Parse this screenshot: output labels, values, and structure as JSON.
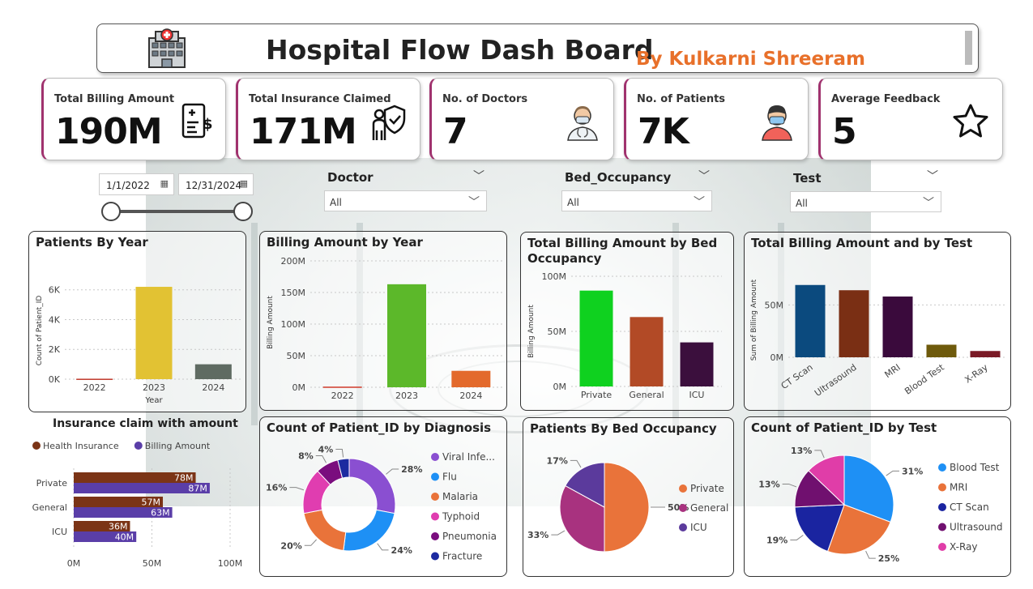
{
  "header": {
    "title": "Hospital Flow Dash Board",
    "author": "By Kulkarni Shreeram"
  },
  "kpis": [
    {
      "label": "Total Billing Amount",
      "value": "190M",
      "icon": "invoice-dollar-icon"
    },
    {
      "label": "Total Insurance Claimed",
      "value": "171M",
      "icon": "insurance-shield-icon"
    },
    {
      "label": "No. of Doctors",
      "value": "7",
      "icon": "doctor-icon"
    },
    {
      "label": "No. of Patients",
      "value": "7K",
      "icon": "patient-mask-icon"
    },
    {
      "label": "Average Feedback",
      "value": "5",
      "icon": "star-icon"
    }
  ],
  "date_filter": {
    "start": "1/1/2022",
    "end": "12/31/2024"
  },
  "slicers": [
    {
      "title": "Doctor",
      "value": "All"
    },
    {
      "title": "Bed_Occupancy",
      "value": "All"
    },
    {
      "title": "Test",
      "value": "All"
    }
  ],
  "colors": {
    "kpi_accent": "#a0326e",
    "author": "#e8702a"
  },
  "chart_data": [
    {
      "id": "patients_by_year",
      "type": "bar",
      "title": "Patients By Year",
      "xlabel": "Year",
      "ylabel": "Count of Patient_ID",
      "categories": [
        "2022",
        "2023",
        "2024"
      ],
      "values": [
        30,
        6200,
        1000
      ],
      "yticks": [
        "0K",
        "2K",
        "4K",
        "6K"
      ],
      "ylim": [
        0,
        6800
      ],
      "colors": [
        "#c0392b",
        "#e2c233",
        "#5f6b62"
      ]
    },
    {
      "id": "billing_by_year",
      "type": "bar",
      "title": "Billing Amount by Year",
      "ylabel": "Billing Amount",
      "categories": [
        "2022",
        "2023",
        "2024"
      ],
      "values": [
        1,
        163,
        26
      ],
      "yticks": [
        "0M",
        "50M",
        "100M",
        "150M",
        "200M"
      ],
      "ylim": [
        0,
        200
      ],
      "colors": [
        "#d03a2a",
        "#5cb82a",
        "#e36a2c"
      ]
    },
    {
      "id": "billing_by_bed",
      "type": "bar",
      "title_lines": [
        "Total Billing Amount by Bed",
        "Occupancy"
      ],
      "ylabel": "Billing Amount",
      "categories": [
        "Private",
        "General",
        "ICU"
      ],
      "values": [
        87,
        63,
        40
      ],
      "yticks": [
        "0M",
        "50M",
        "100M"
      ],
      "ylim": [
        0,
        100
      ],
      "colors": [
        "#0fd11f",
        "#b24a26",
        "#3b0f3d"
      ]
    },
    {
      "id": "billing_by_test",
      "type": "bar",
      "title": "Total Billing Amount and by Test",
      "ylabel": "Sum of Billing Amount",
      "categories": [
        "CT Scan",
        "Ultrasound",
        "MRI",
        "Blood Test",
        "X-Ray"
      ],
      "values": [
        69,
        64,
        58,
        12,
        6
      ],
      "yticks": [
        "0M",
        "50M"
      ],
      "ylim": [
        0,
        75
      ],
      "colors": [
        "#0b4a7e",
        "#7a2f14",
        "#3a0a3c",
        "#6e5a0c",
        "#7a1a26"
      ]
    },
    {
      "id": "insurance_claim",
      "type": "bar",
      "orientation": "horizontal",
      "title": "Insurance claim with amount",
      "categories": [
        "Private",
        "General",
        "ICU"
      ],
      "series": [
        {
          "name": "Health Insurance",
          "values": [
            78,
            57,
            36
          ],
          "labels": [
            "78M",
            "57M",
            "36M"
          ],
          "color": "#7b3416"
        },
        {
          "name": "Billing Amount",
          "values": [
            87,
            63,
            40
          ],
          "labels": [
            "87M",
            "63M",
            "40M"
          ],
          "color": "#5a3ea8"
        }
      ],
      "xticks": [
        "0M",
        "50M",
        "100M"
      ],
      "xlim": [
        0,
        100
      ]
    },
    {
      "id": "diagnosis_donut",
      "type": "pie",
      "donut": true,
      "title": "Count of Patient_ID by Diagnosis",
      "slices": [
        {
          "label": "Viral Infe...",
          "value": 28,
          "pct": "28%",
          "color": "#8a4fd1"
        },
        {
          "label": "Flu",
          "value": 24,
          "pct": "24%",
          "color": "#1e90f5"
        },
        {
          "label": "Malaria",
          "value": 20,
          "pct": "20%",
          "color": "#e9733a"
        },
        {
          "label": "Typhoid",
          "value": 16,
          "pct": "16%",
          "color": "#e03db0"
        },
        {
          "label": "Pneumonia",
          "value": 8,
          "pct": "8%",
          "color": "#7a0d7e"
        },
        {
          "label": "Fracture",
          "value": 4,
          "pct": "4%",
          "color": "#1c2aa0"
        }
      ]
    },
    {
      "id": "bed_pie",
      "type": "pie",
      "title": "Patients By Bed Occupancy",
      "slices": [
        {
          "label": "Private",
          "value": 50,
          "pct": "50%",
          "color": "#e9733a"
        },
        {
          "label": "General",
          "value": 33,
          "pct": "33%",
          "color": "#a8327f"
        },
        {
          "label": "ICU",
          "value": 17,
          "pct": "17%",
          "color": "#5b3a9c"
        }
      ]
    },
    {
      "id": "test_pie",
      "type": "pie",
      "title": "Count of Patient_ID by Test",
      "slices": [
        {
          "label": "Blood Test",
          "value": 31,
          "pct": "31%",
          "color": "#1e90f5"
        },
        {
          "label": "MRI",
          "value": 25,
          "pct": "25%",
          "color": "#e9733a"
        },
        {
          "label": "CT Scan",
          "value": 19,
          "pct": "19%",
          "color": "#1a24a0"
        },
        {
          "label": "Ultrasound",
          "value": 13,
          "pct": "13%",
          "color": "#70106f"
        },
        {
          "label": "X-Ray",
          "value": 13,
          "pct": "13%",
          "color": "#e03da8"
        }
      ]
    }
  ]
}
